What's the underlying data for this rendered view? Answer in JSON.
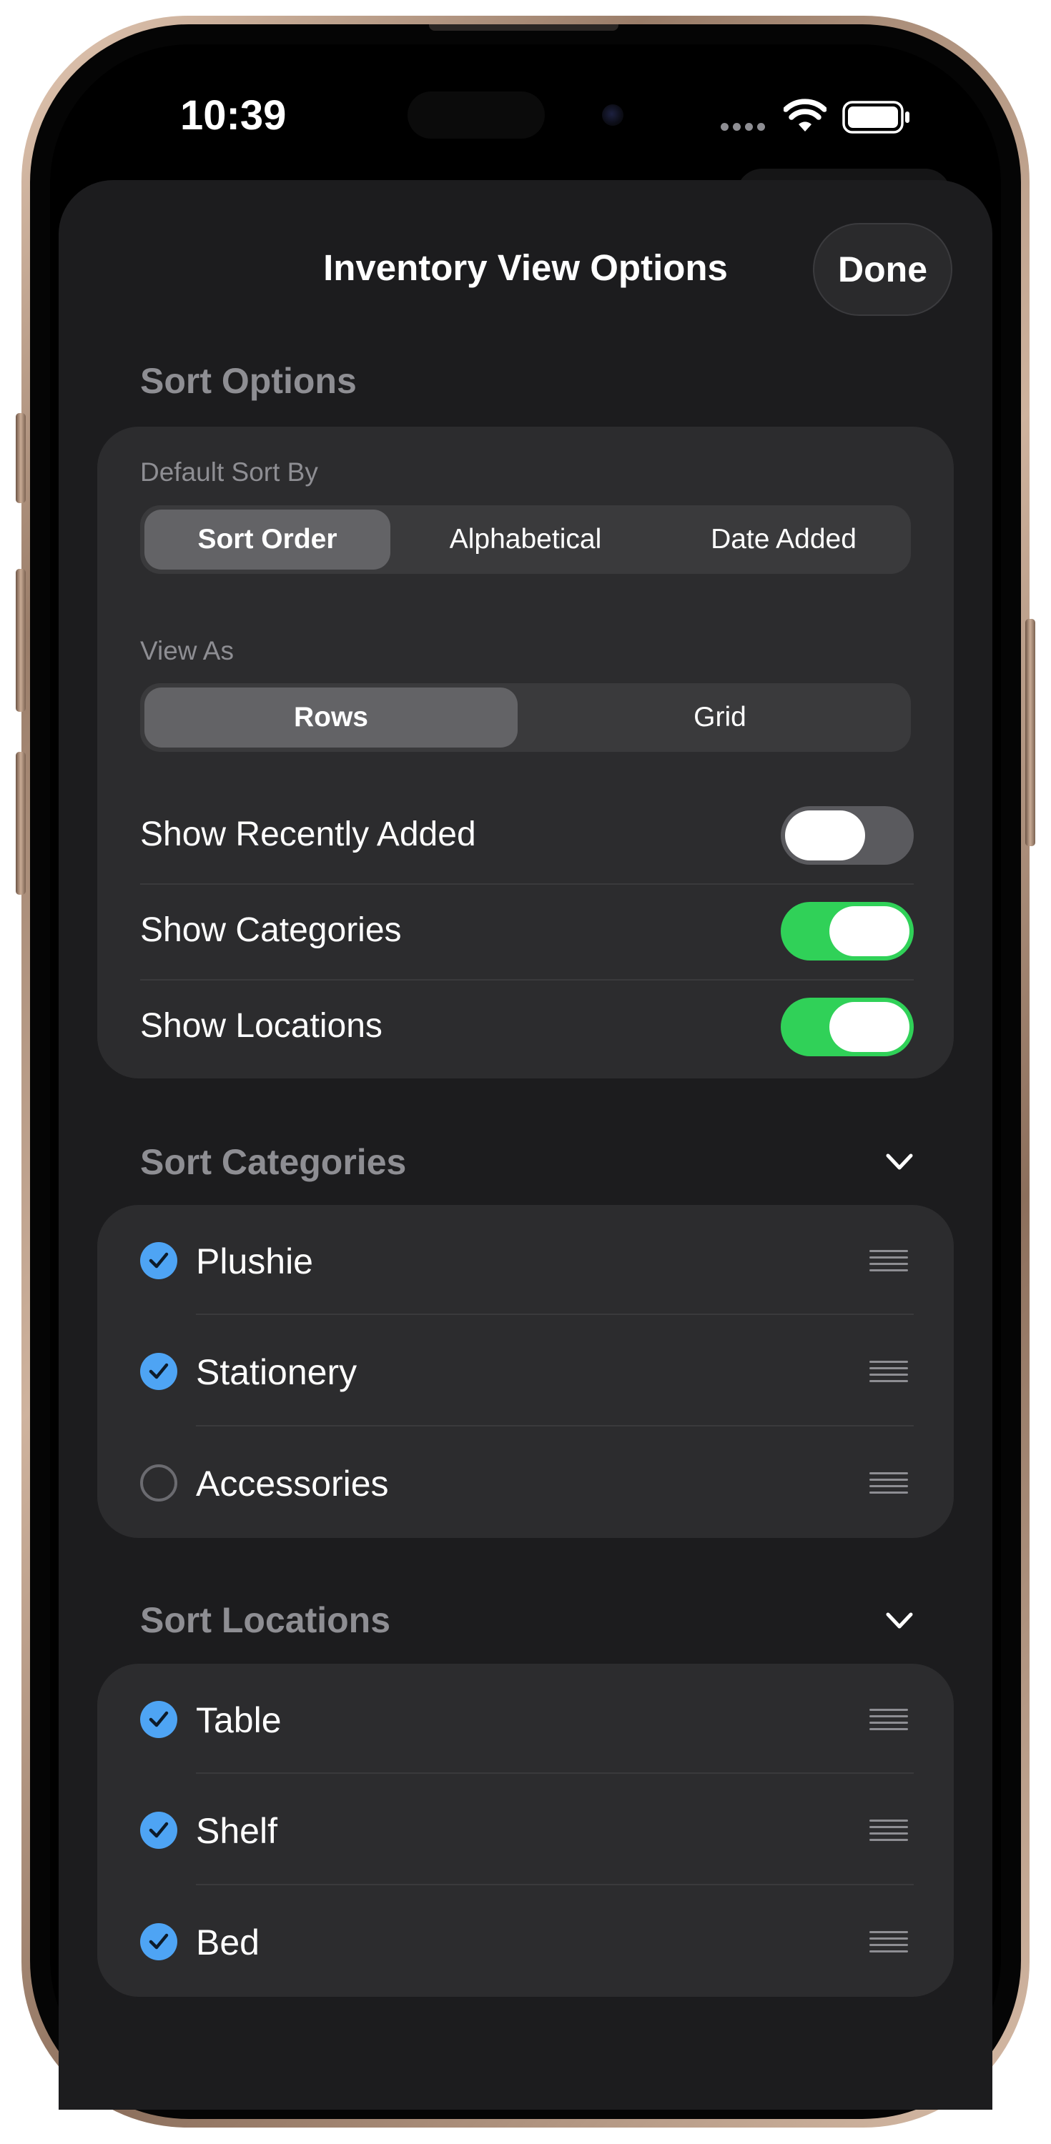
{
  "status_bar": {
    "time": "10:39"
  },
  "nav": {
    "title": "Inventory View Options",
    "done_label": "Done"
  },
  "sort_options": {
    "header": "Sort Options",
    "default_sort": {
      "label": "Default Sort By",
      "options": [
        "Sort Order",
        "Alphabetical",
        "Date Added"
      ],
      "selected": "Sort Order"
    },
    "view_as": {
      "label": "View As",
      "options": [
        "Rows",
        "Grid"
      ],
      "selected": "Rows"
    },
    "toggles": [
      {
        "label": "Show Recently Added",
        "on": false
      },
      {
        "label": "Show Categories",
        "on": true
      },
      {
        "label": "Show Locations",
        "on": true
      }
    ]
  },
  "sort_categories": {
    "header": "Sort Categories",
    "items": [
      {
        "label": "Plushie",
        "checked": true
      },
      {
        "label": "Stationery",
        "checked": true
      },
      {
        "label": "Accessories",
        "checked": false
      }
    ]
  },
  "sort_locations": {
    "header": "Sort Locations",
    "items": [
      {
        "label": "Table",
        "checked": true
      },
      {
        "label": "Shelf",
        "checked": true
      },
      {
        "label": "Bed",
        "checked": true
      }
    ]
  },
  "colors": {
    "sheet_background": "#1c1c1e",
    "card_background": "#2c2c2e",
    "toggle_on": "#30d158",
    "checkmark_accent": "#4ea4f4",
    "secondary_text": "#8e8e93"
  }
}
